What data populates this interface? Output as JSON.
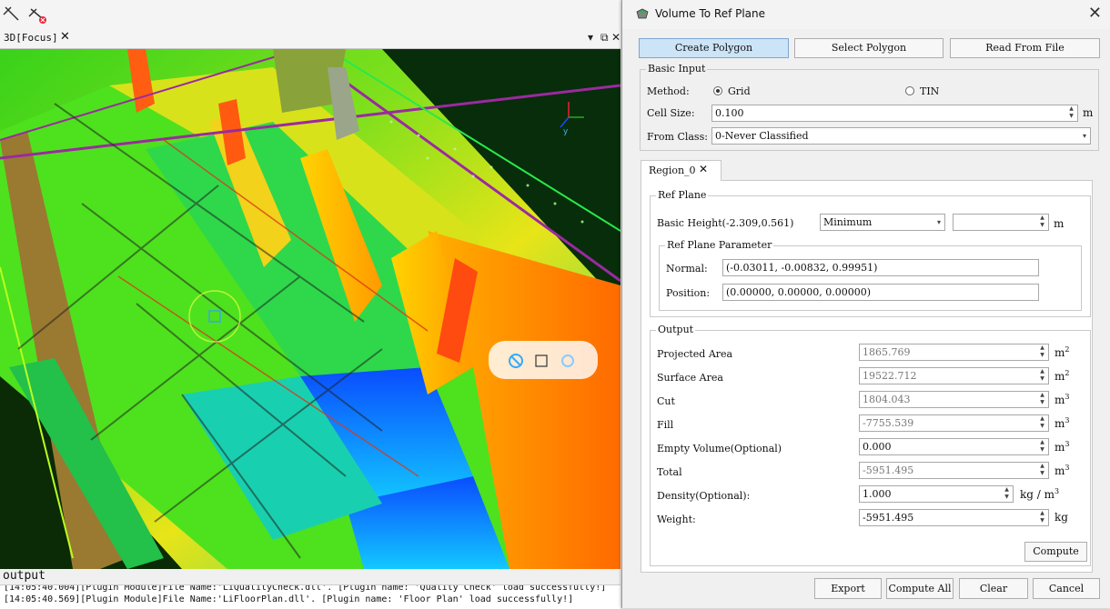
{
  "toolbar": {
    "icons": [
      "measure-line-icon",
      "measure-clear-icon"
    ]
  },
  "view": {
    "tab_label": "3D[Focus]",
    "close_glyph": "✕",
    "float_glyph": "⧉",
    "close_view_glyph": "✕"
  },
  "output": {
    "title": "output",
    "log": [
      "[14:05:40.004][Plugin Module]File Name:'LiQualityCheck.dll'.   [Plugin name: 'Quality Check' load successfully!]",
      "[14:05:40.569][Plugin Module]File Name:'LiFloorPlan.dll'.   [Plugin name: 'Floor Plan' load successfully!]"
    ]
  },
  "dialog": {
    "title": "Volume To Ref Plane",
    "top_buttons": [
      "Create Polygon",
      "Select Polygon",
      "Read From File"
    ],
    "basic_input": {
      "title": "Basic Input",
      "method_label": "Method:",
      "method_options": [
        "Grid",
        "TIN"
      ],
      "method_selected": "Grid",
      "cell_size_label": "Cell Size:",
      "cell_size_value": "0.100",
      "cell_size_unit": "m",
      "from_class_label": "From Class:",
      "from_class_value": "0-Never Classified"
    },
    "region_tab": {
      "label": "Region_0",
      "close": "✕"
    },
    "ref_plane": {
      "title": "Ref Plane",
      "basic_height_label": "Basic Height(-2.309,0.561)",
      "basic_height_mode": "Minimum",
      "basic_height_value": "",
      "unit": "m",
      "param_title": "Ref Plane Parameter",
      "normal_label": "Normal:",
      "normal_value": "(-0.03011, -0.00832, 0.99951)",
      "position_label": "Position:",
      "position_value": "(0.00000, 0.00000, 0.00000)"
    },
    "output": {
      "title": "Output",
      "rows": [
        {
          "label": "Projected Area",
          "value": "1865.769",
          "unit": "m",
          "sup": "2",
          "editable": false
        },
        {
          "label": "Surface Area",
          "value": "19522.712",
          "unit": "m",
          "sup": "2",
          "editable": false
        },
        {
          "label": "Cut",
          "value": "1804.043",
          "unit": "m",
          "sup": "3",
          "editable": false
        },
        {
          "label": "Fill",
          "value": "-7755.539",
          "unit": "m",
          "sup": "3",
          "editable": false
        },
        {
          "label": "Empty Volume(Optional)",
          "value": "0.000",
          "unit": "m",
          "sup": "3",
          "editable": true
        },
        {
          "label": "Total",
          "value": "-5951.495",
          "unit": "m",
          "sup": "3",
          "editable": false
        },
        {
          "label": "Density(Optional):",
          "value": "1.000",
          "unit": "kg / m",
          "sup": "3",
          "editable": true
        },
        {
          "label": "Weight:",
          "value": "-5951.495",
          "unit": "kg",
          "sup": "",
          "editable": true
        }
      ],
      "compute_label": "Compute"
    },
    "bottom_buttons": [
      "Export",
      "Compute All",
      "Clear",
      "Cancel"
    ]
  }
}
